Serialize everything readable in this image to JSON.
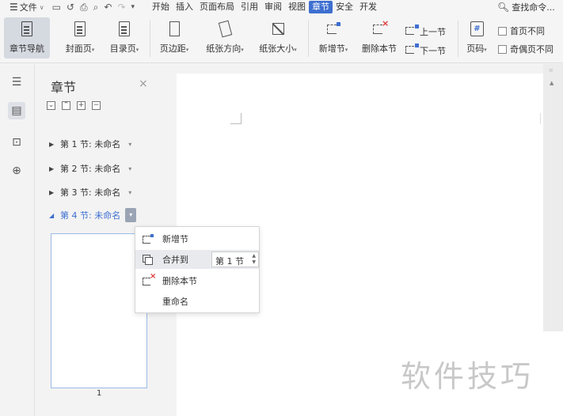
{
  "menubar": {
    "file_label": "文件",
    "tabs": [
      {
        "label": "开始",
        "active": false
      },
      {
        "label": "插入",
        "active": false
      },
      {
        "label": "页面布局",
        "active": false
      },
      {
        "label": "引用",
        "active": false
      },
      {
        "label": "审阅",
        "active": false
      },
      {
        "label": "视图",
        "active": false
      },
      {
        "label": "章节",
        "active": true
      },
      {
        "label": "安全",
        "active": false
      },
      {
        "label": "开发",
        "active": false
      }
    ],
    "search_label": "查找命令..."
  },
  "ribbon": {
    "chapter_nav": "章节导航",
    "cover": "封面页",
    "toc": "目录页",
    "margin": "页边距",
    "orientation": "纸张方向",
    "size": "纸张大小",
    "new_section": "新增节",
    "delete_section": "删除本节",
    "prev_section": "上一节",
    "next_section": "下一节",
    "page_number": "页码",
    "first_page_diff": "首页不同",
    "odd_even_diff": "奇偶页不同"
  },
  "panel": {
    "title": "章节",
    "sections": [
      {
        "label": "第 1 节: 未命名",
        "active": false
      },
      {
        "label": "第 2 节: 未命名",
        "active": false
      },
      {
        "label": "第 3 节: 未命名",
        "active": false
      },
      {
        "label": "第 4 节: 未命名",
        "active": true
      }
    ],
    "thumb_page": "1"
  },
  "context_menu": {
    "new_section": "新增节",
    "merge_to": "合并到",
    "merge_target": "第 1 节",
    "delete_section": "删除本节",
    "rename": "重命名"
  },
  "watermark": "软件技巧",
  "colors": {
    "accent": "#3e6fd0",
    "delete_red": "#d33333"
  }
}
